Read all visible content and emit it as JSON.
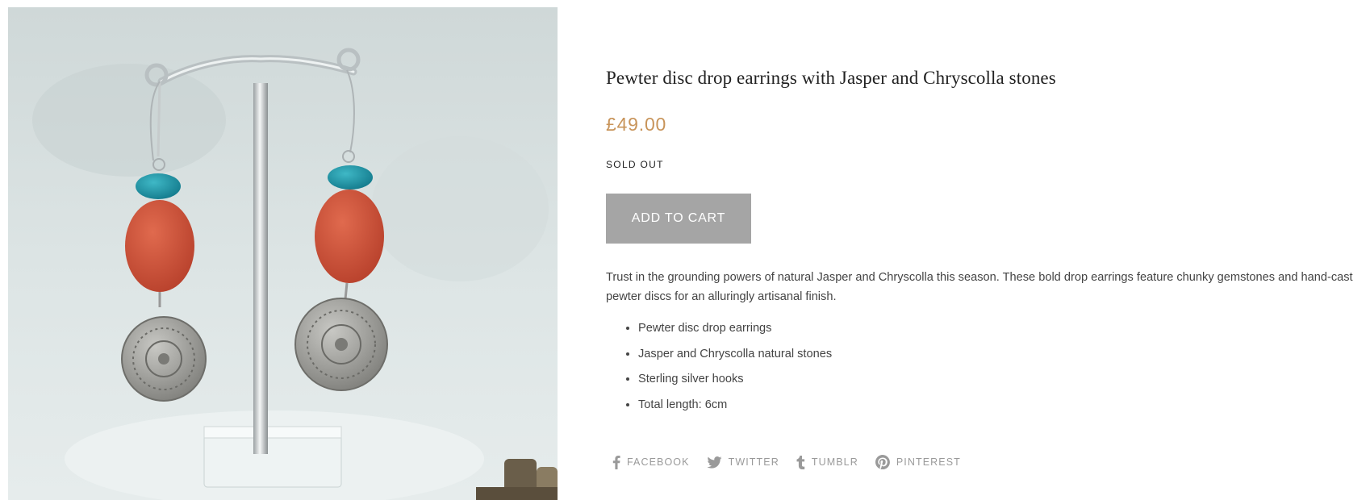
{
  "product": {
    "image_alt": "Pewter disc drop earrings with Jasper and Chryscolla stones",
    "title": "Pewter disc drop earrings with Jasper and Chryscolla stones",
    "price": "£49.00",
    "availability": "SOLD OUT",
    "add_to_cart_label": "ADD TO CART",
    "description": "Trust in the grounding powers of natural Jasper and Chryscolla this season. These bold drop earrings feature chunky gemstones and hand-cast pewter discs for an alluringly artisanal finish.",
    "features": [
      "Pewter disc drop earrings",
      "Jasper and Chryscolla natural stones",
      "Sterling silver hooks",
      "Total length: 6cm"
    ]
  },
  "share": {
    "items": [
      {
        "label": "FACEBOOK",
        "icon": "facebook-icon"
      },
      {
        "label": "TWITTER",
        "icon": "twitter-icon"
      },
      {
        "label": "TUMBLR",
        "icon": "tumblr-icon"
      },
      {
        "label": "PINTEREST",
        "icon": "pinterest-icon"
      }
    ]
  },
  "colors": {
    "price": "#c8945a",
    "button": "#a5a5a5",
    "share_text": "#9a9a9a"
  }
}
